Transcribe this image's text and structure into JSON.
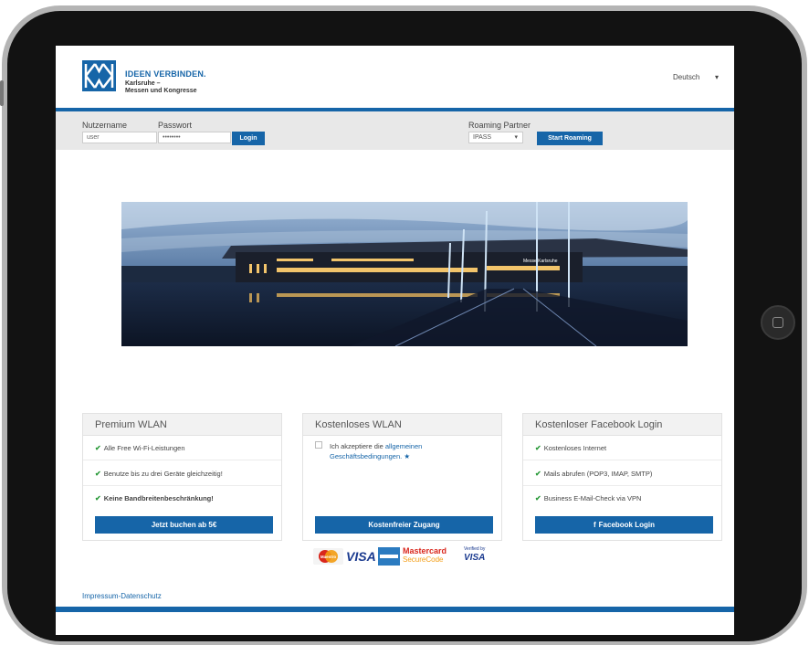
{
  "header": {
    "logo_text": "KMK",
    "tagline": "IDEEN VERBINDEN.",
    "sub_line1": "Karlsruhe –",
    "sub_line2": "Messen und Kongresse",
    "language": "Deutsch",
    "language_caret": "▾"
  },
  "login": {
    "username_label": "Nutzername",
    "username_value": "user",
    "password_label": "Passwort",
    "password_value": "••••••••",
    "login_button": "Login",
    "roaming_label": "Roaming Partner",
    "roaming_value": "IPASS",
    "roaming_caret": "▾",
    "roaming_button": "Start Roaming"
  },
  "cards": [
    {
      "title": "Premium WLAN",
      "features": [
        "Alle Free Wi-Fi-Leistungen",
        "Benutze bis zu drei Geräte gleichzeitig!",
        "Keine Bandbreitenbeschränkung!"
      ],
      "button": "Jetzt buchen ab 5€"
    },
    {
      "title": "Kostenloses WLAN",
      "terms_prefix": "Ich akzeptiere die ",
      "terms_link": "allgemeinen Geschäftsbedingungen.",
      "terms_star": "★",
      "button": "Kostenfreier Zugang"
    },
    {
      "title": "Kostenloser Facebook Login",
      "features": [
        "Kostenloses Internet",
        "Mails abrufen (POP3, IMAP, SMTP)",
        "Business E-Mail-Check via VPN"
      ],
      "button": "Facebook Login"
    }
  ],
  "payment": {
    "maestro": "Maestro",
    "visa": "VISA",
    "mc_line1": "Mastercard",
    "mc_line2": "SecureCode",
    "vbv_line1": "Verified by",
    "vbv_line2": "VISA"
  },
  "footer": {
    "link": "Impressum-Datenschutz"
  },
  "colors": {
    "accent": "#1665a8",
    "check": "#2a9a3a"
  },
  "icons": {
    "check": "✔",
    "facebook": "f"
  }
}
